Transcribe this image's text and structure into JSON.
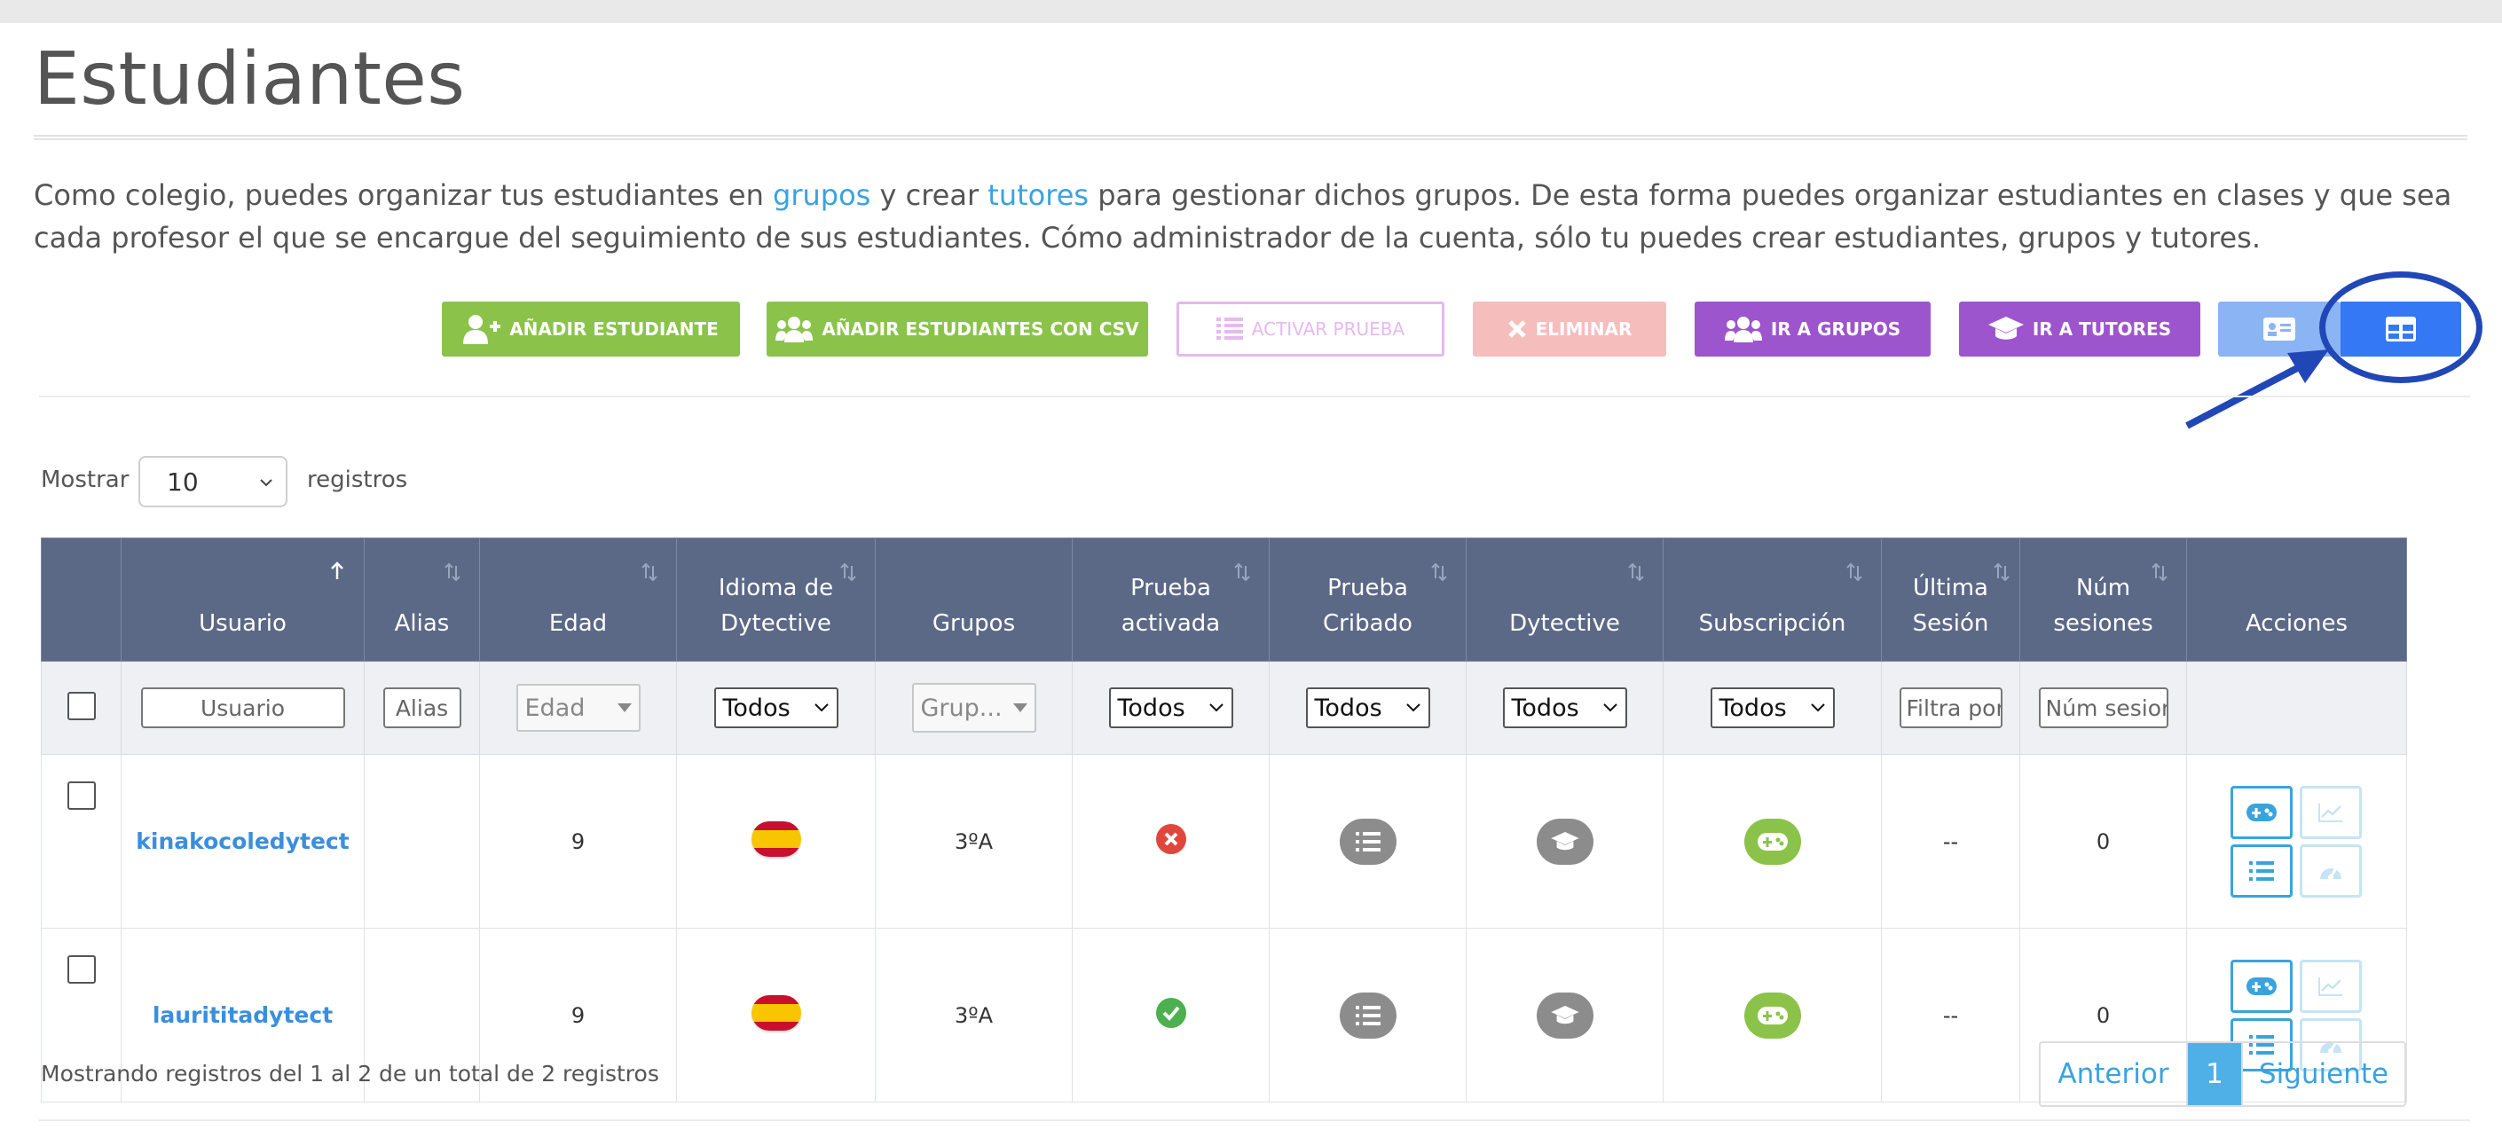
{
  "page": {
    "title": "Estudiantes",
    "intro": {
      "part1": "Como colegio, puedes organizar tus estudiantes en ",
      "link_groups": "grupos",
      "part2": " y crear ",
      "link_tutors": "tutores",
      "part3": " para gestionar dichos grupos. De esta forma puedes organizar estudiantes en clases y que sea cada profesor el que se encargue del seguimiento de sus estudiantes. Cómo administrador de la cuenta, sólo tu puedes crear estudiantes, grupos y tutores."
    }
  },
  "toolbar": {
    "add_student": "AÑADIR ESTUDIANTE",
    "add_students_csv": "AÑADIR ESTUDIANTES CON CSV",
    "activate_test": "ACTIVAR PRUEBA",
    "delete": "ELIMINAR",
    "go_groups": "IR A GRUPOS",
    "go_tutors": "IR A TUTORES",
    "colors": {
      "green": "#8bc34a",
      "purple": "#9c55cc",
      "red_disabled": "#f6bdbd",
      "blue_active": "#3478f6",
      "blue_light": "#8ab4f4"
    }
  },
  "length": {
    "label_before": "Mostrar",
    "value": "10",
    "label_after": "registros"
  },
  "table": {
    "headers": {
      "usuario": "Usuario",
      "alias": "Alias",
      "edad": "Edad",
      "idioma_l1": "Idioma de",
      "idioma_l2": "Dytective",
      "grupos": "Grupos",
      "prueba_act_l1": "Prueba",
      "prueba_act_l2": "activada",
      "prueba_crib_l1": "Prueba",
      "prueba_crib_l2": "Cribado",
      "dytective": "Dytective",
      "subscripcion": "Subscripción",
      "ultima_l1": "Última",
      "ultima_l2": "Sesión",
      "num_l1": "Núm",
      "num_l2": "sesiones",
      "acciones": "Acciones"
    },
    "filters": {
      "usuario": "Usuario",
      "alias": "Alias",
      "edad": "Edad",
      "idioma": "Todos",
      "grupos": "Grup...",
      "prueba_activada": "Todos",
      "prueba_cribado": "Todos",
      "dytective": "Todos",
      "subscripcion": "Todos",
      "ultima_sesion_placeholder": "Filtra por",
      "num_sesiones_placeholder": "Núm sesion"
    },
    "rows": [
      {
        "usuario": "kinakocoledytect",
        "alias": "",
        "edad": "9",
        "idioma": "es-flag",
        "grupos": "3ºA",
        "prueba_activada": "no",
        "ultima_sesion": "--",
        "num_sesiones": "0"
      },
      {
        "usuario": "laurititadytect",
        "alias": "",
        "edad": "9",
        "idioma": "es-flag",
        "grupos": "3ºA",
        "prueba_activada": "yes",
        "ultima_sesion": "--",
        "num_sesiones": "0"
      }
    ]
  },
  "footer": {
    "info": "Mostrando registros del 1 al 2 de un total de 2 registros",
    "prev": "Anterior",
    "current": "1",
    "next": "Siguiente"
  }
}
